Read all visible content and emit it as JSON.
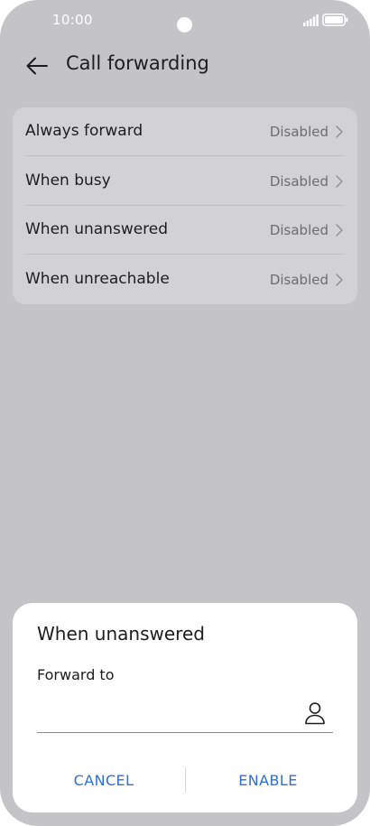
{
  "status_bar": {
    "time": "10:00"
  },
  "header": {
    "title": "Call forwarding"
  },
  "settings": {
    "items": [
      {
        "label": "Always forward",
        "value": "Disabled"
      },
      {
        "label": "When busy",
        "value": "Disabled"
      },
      {
        "label": "When unanswered",
        "value": "Disabled"
      },
      {
        "label": "When unreachable",
        "value": "Disabled"
      }
    ]
  },
  "dialog": {
    "title": "When unanswered",
    "field_label": "Forward to",
    "field_value": "",
    "cancel_label": "CANCEL",
    "enable_label": "ENABLE"
  },
  "icons": {
    "back": "arrow-left-icon",
    "chevron": "chevron-right-icon",
    "contact": "person-icon",
    "signal": "signal-icon",
    "battery": "battery-icon"
  },
  "colors": {
    "background": "#c4c4c6",
    "card": "#d2d2d4",
    "dialog": "#ffffff",
    "accent": "#2f6fd6",
    "secondary_text": "#6d6d70"
  }
}
